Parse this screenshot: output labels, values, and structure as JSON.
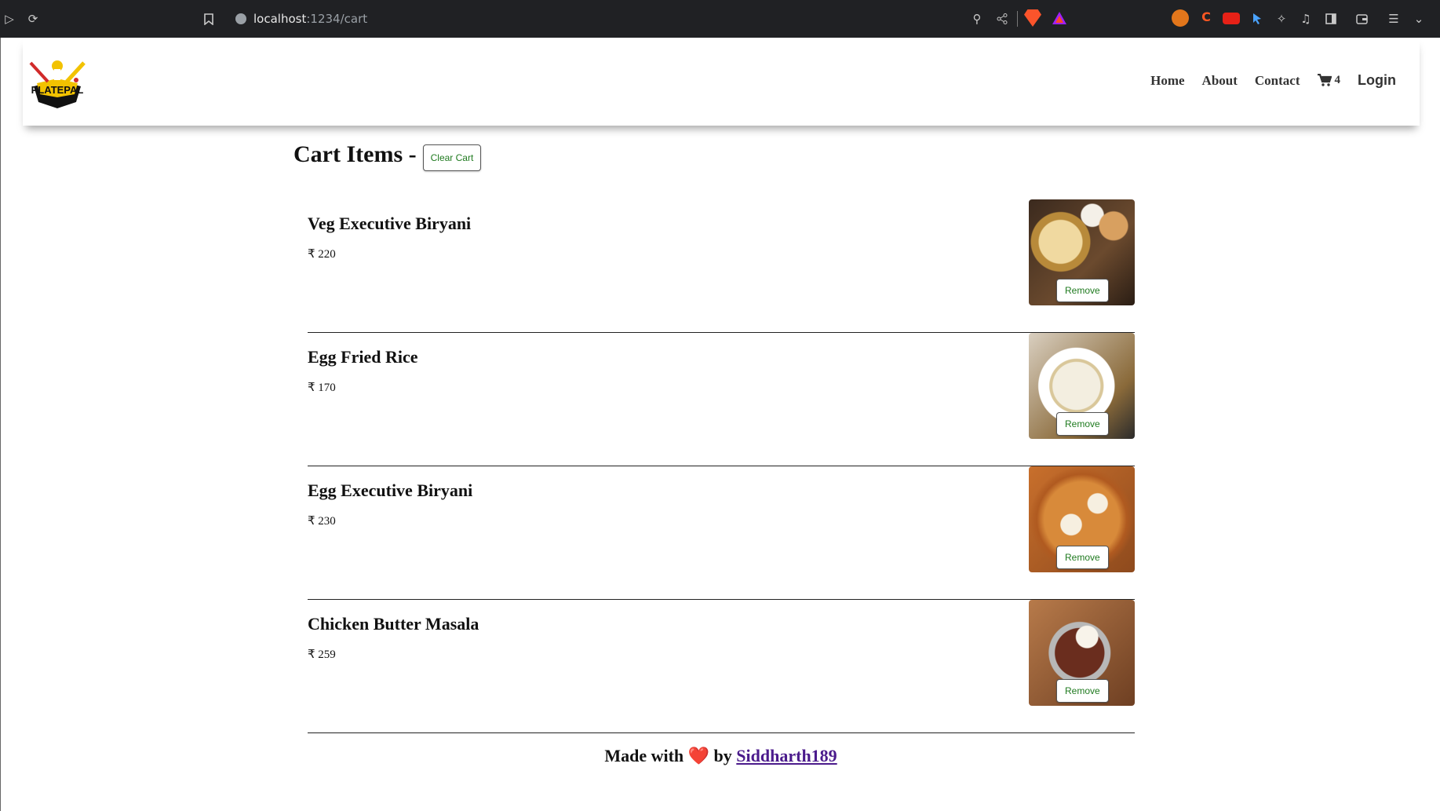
{
  "browser": {
    "url_host": "localhost",
    "url_path": ":1234/cart",
    "icons": [
      "play-icon",
      "reload-icon",
      "bookmark-icon",
      "info-icon",
      "zoom-icon",
      "share-icon",
      "brave-shield-icon",
      "rewards-icon",
      "metamask-icon",
      "extension-c-icon",
      "youtube-icon",
      "cursor-icon",
      "puzzle-icon",
      "music-icon",
      "sidebar-icon",
      "wallet-icon",
      "menu-icon",
      "chevron-down-icon"
    ]
  },
  "navbar": {
    "logo_text": "PLATEPAL",
    "links": [
      "Home",
      "About",
      "Contact"
    ],
    "cart_count": "4",
    "login": "Login"
  },
  "cart": {
    "title": "Cart Items -",
    "clear_label": "Clear Cart",
    "remove_label": "Remove",
    "items": [
      {
        "name": "Veg Executive Biryani",
        "price": "₹ 220"
      },
      {
        "name": "Egg Fried Rice",
        "price": "₹ 170"
      },
      {
        "name": "Egg Executive Biryani",
        "price": "₹ 230"
      },
      {
        "name": "Chicken Butter Masala",
        "price": "₹ 259"
      }
    ]
  },
  "footer": {
    "prefix": "Made with",
    "heart": "❤️",
    "by": "by",
    "author": "Siddharth189"
  },
  "colors": {
    "chrome_bg": "#202124",
    "button_text": "#1f7a1f",
    "link": "#4b1b8c",
    "heart": "#e0302f"
  }
}
